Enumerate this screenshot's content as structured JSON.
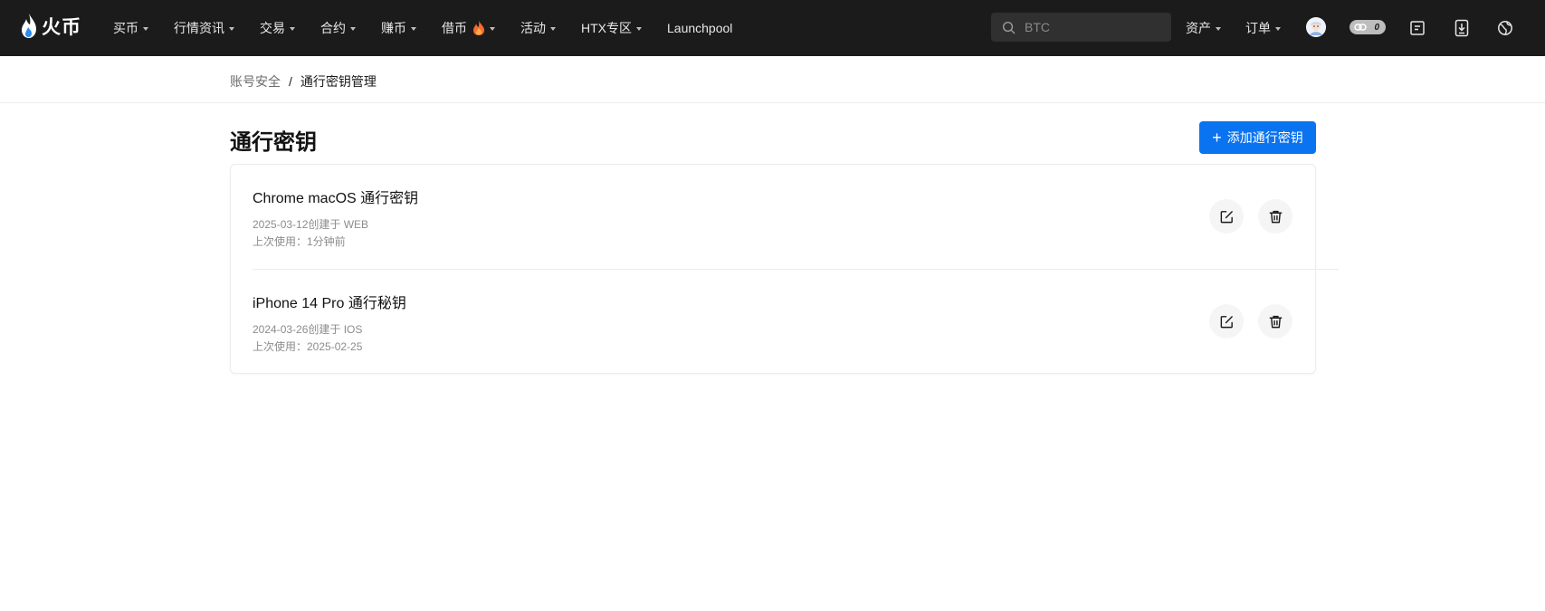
{
  "header": {
    "logo_text": "火币",
    "nav": [
      {
        "label": "买币",
        "has_caret": true
      },
      {
        "label": "行情资讯",
        "has_caret": true
      },
      {
        "label": "交易",
        "has_caret": true
      },
      {
        "label": "合约",
        "has_caret": true
      },
      {
        "label": "赚币",
        "has_caret": true
      },
      {
        "label": "借币",
        "has_caret": true,
        "hot_icon": "fire-icon"
      },
      {
        "label": "活动",
        "has_caret": true
      },
      {
        "label": "HTX专区",
        "has_caret": true
      },
      {
        "label": "Launchpool",
        "has_caret": false
      }
    ],
    "search": {
      "placeholder": "BTC",
      "icon": "search-icon"
    },
    "right_nav": [
      {
        "label": "资产",
        "has_caret": true
      },
      {
        "label": "订单",
        "has_caret": true
      }
    ],
    "notification_count": "0",
    "icons": [
      "avatar",
      "badge-pill",
      "notifications-icon",
      "download-icon",
      "language-icon"
    ]
  },
  "breadcrumb": {
    "parent": "账号安全",
    "separator": "/",
    "current": "通行密钥管理"
  },
  "page": {
    "title": "通行密钥",
    "add_button_label": "添加通行密钥"
  },
  "passkeys": [
    {
      "name": "Chrome macOS 通行密钥",
      "created": "2025-03-12创建于 WEB",
      "last_used": "上次使用：1分钟前"
    },
    {
      "name": "iPhone 14 Pro 通行秘钥",
      "created": "2024-03-26创建于 IOS",
      "last_used": "上次使用：2025-02-25"
    }
  ],
  "colors": {
    "navbar_bg": "#1b1b1b",
    "accent": "#0a73f0",
    "muted_text": "#8c8c8c"
  }
}
